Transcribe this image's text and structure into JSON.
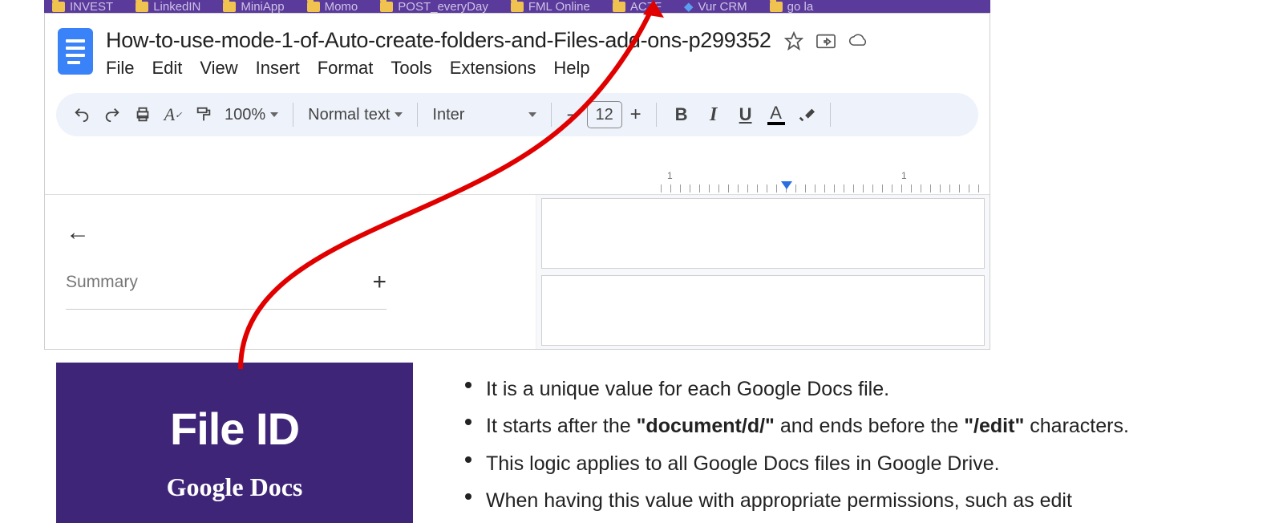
{
  "bookmarks": {
    "items": [
      {
        "label": "INVEST"
      },
      {
        "label": "LinkedIN"
      },
      {
        "label": "MiniApp"
      },
      {
        "label": "Momo"
      },
      {
        "label": "POST_everyDay"
      },
      {
        "label": "FML Online"
      },
      {
        "label": "ACZF"
      },
      {
        "label": "Vur CRM"
      },
      {
        "label": "go la"
      }
    ]
  },
  "doc": {
    "title": "How-to-use-mode-1-of-Auto-create-folders-and-Files-add-ons-p299352",
    "menu": {
      "file": "File",
      "edit": "Edit",
      "view": "View",
      "insert": "Insert",
      "format": "Format",
      "tools": "Tools",
      "extensions": "Extensions",
      "help": "Help"
    }
  },
  "toolbar": {
    "zoom": "100%",
    "style": "Normal text",
    "font": "Inter",
    "font_size": "12"
  },
  "ruler": {
    "left_num": "1",
    "right_num": "1"
  },
  "summary": {
    "label": "Summary"
  },
  "callout": {
    "title": "File ID",
    "subtitle": "Google Docs"
  },
  "bullets": {
    "b1": "It is a unique value for each Google Docs file.",
    "b2_pre": "It starts after the ",
    "b2_bold1": "\"document/d/\"",
    "b2_mid": " and ends before the ",
    "b2_bold2": "\"/edit\"",
    "b2_post": " characters.",
    "b3": "This logic applies to all Google Docs files in Google Drive.",
    "b4": "When having this value with appropriate permissions, such as edit"
  }
}
